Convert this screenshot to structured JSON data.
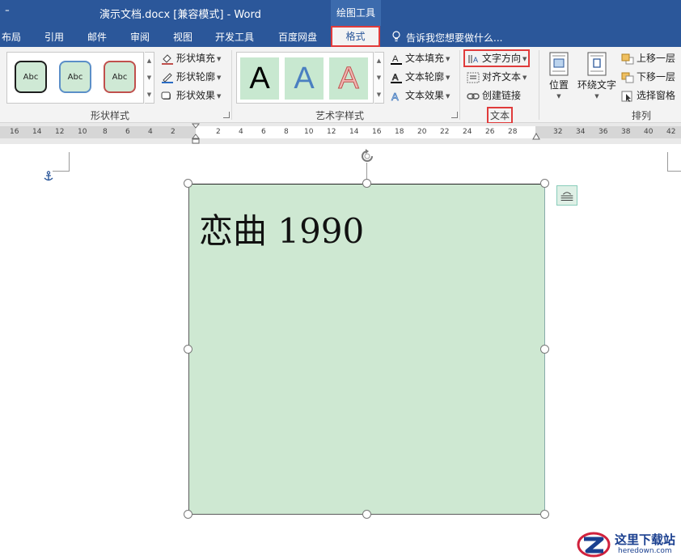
{
  "window": {
    "qat_glyph": "⁼",
    "title": "演示文档.docx [兼容模式] - Word",
    "context_tab": "绘图工具"
  },
  "tabs": [
    {
      "label": "布局"
    },
    {
      "label": "引用"
    },
    {
      "label": "邮件"
    },
    {
      "label": "审阅"
    },
    {
      "label": "视图"
    },
    {
      "label": "开发工具"
    },
    {
      "label": "百度网盘"
    },
    {
      "label": "格式",
      "active": true
    }
  ],
  "tell_me": {
    "placeholder": "告诉我您想要做什么..."
  },
  "ribbon": {
    "shape_styles": {
      "label": "形状样式",
      "presets": [
        {
          "text": "Abc",
          "border": "#1e1e1e"
        },
        {
          "text": "Abc",
          "border": "#5b8fc8"
        },
        {
          "text": "Abc",
          "border": "#c0504d"
        }
      ],
      "commands": [
        {
          "label": "形状填充",
          "icon": "paint-bucket-icon"
        },
        {
          "label": "形状轮廓",
          "icon": "pen-outline-icon"
        },
        {
          "label": "形状效果",
          "icon": "shape-effects-icon"
        }
      ]
    },
    "wordart_styles": {
      "label": "艺术字样式",
      "presets": [
        {
          "text": "A",
          "color": "#000000"
        },
        {
          "text": "A",
          "color": "#4a7fc1"
        },
        {
          "text": "A",
          "color": "#f2b7b4"
        }
      ],
      "commands": [
        {
          "label": "文本填充",
          "icon": "text-fill-icon"
        },
        {
          "label": "文本轮廓",
          "icon": "text-outline-icon"
        },
        {
          "label": "文本效果",
          "icon": "text-effects-icon"
        }
      ]
    },
    "text_group": {
      "label": "文本",
      "commands": [
        {
          "label": "文字方向",
          "icon": "text-direction-icon",
          "highlighted": true
        },
        {
          "label": "对齐文本",
          "icon": "align-text-icon"
        },
        {
          "label": "创建链接",
          "icon": "link-icon"
        }
      ]
    },
    "arrange": {
      "label": "排列",
      "position_label": "位置",
      "wrap_label": "环绕文字",
      "commands": [
        {
          "label": "上移一层",
          "icon": "bring-forward-icon"
        },
        {
          "label": "下移一层",
          "icon": "send-backward-icon"
        },
        {
          "label": "选择窗格",
          "icon": "selection-pane-icon"
        }
      ]
    }
  },
  "ruler": {
    "left_numbers": [
      "16",
      "14",
      "12",
      "10",
      "8",
      "6",
      "4",
      "2"
    ],
    "mid_numbers": [
      "2",
      "4",
      "6",
      "8",
      "10",
      "12",
      "14",
      "16",
      "18",
      "20",
      "22",
      "24",
      "26",
      "28"
    ],
    "right_numbers": [
      "32",
      "34",
      "36",
      "38",
      "40",
      "42"
    ]
  },
  "document": {
    "textbox_text": "恋曲 1990",
    "shape_fill": "#cee8d2"
  },
  "watermark": {
    "cn": "这里下载站",
    "en": "heredown.com"
  },
  "colors": {
    "titlebar": "#2b579a",
    "highlight_box": "#e03b3b"
  }
}
